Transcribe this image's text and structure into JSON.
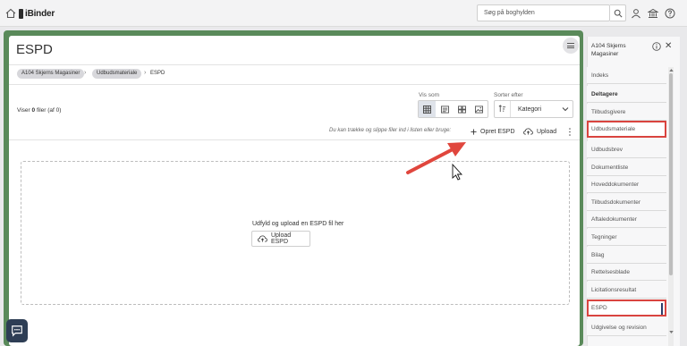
{
  "app": {
    "logo": "iBinder"
  },
  "search": {
    "placeholder": "Søg på boghylden"
  },
  "page": {
    "title": "ESPD"
  },
  "breadcrumb": {
    "items": [
      "A104 Skjerns Magasiner",
      "Udbudsmateriale",
      "ESPD"
    ]
  },
  "toolbar": {
    "view_label": "Vis som",
    "sort_label": "Sorter efter",
    "sort_value": "Kategori",
    "count_prefix": "Viser",
    "count_number": "0",
    "count_unit": "filer",
    "count_suffix": "(af 0)",
    "drag_hint": "Du kan trække og slippe filer ind i listen eller bruge:",
    "create_label": "Opret ESPD",
    "upload_label": "Upload"
  },
  "dropzone": {
    "text": "Udfyld og upload en ESPD fil her",
    "button_label": "Upload ESPD"
  },
  "sidebar": {
    "title": "A104 Skjerns Magasiner",
    "items": [
      {
        "label": "Indeks"
      },
      {
        "label": "Deltagere"
      },
      {
        "label": "Tilbudsgivere"
      },
      {
        "label": "Udbudsmateriale"
      },
      {
        "label": "Udbudsbrev"
      },
      {
        "label": "Dokumentliste"
      },
      {
        "label": "Hoveddokumenter"
      },
      {
        "label": "Tilbudsdokumenter"
      },
      {
        "label": "Aftaledokumenter"
      },
      {
        "label": "Tegninger"
      },
      {
        "label": "Bilag"
      },
      {
        "label": "Rettelsesblade"
      },
      {
        "label": "Licitationsresultat"
      },
      {
        "label": "ESPD"
      },
      {
        "label": "Udgivelse og revision"
      }
    ]
  },
  "colors": {
    "frame": "#5a8a5a",
    "highlight": "#d9443f",
    "arrow": "#e0463d",
    "chat": "#2e3e55"
  }
}
